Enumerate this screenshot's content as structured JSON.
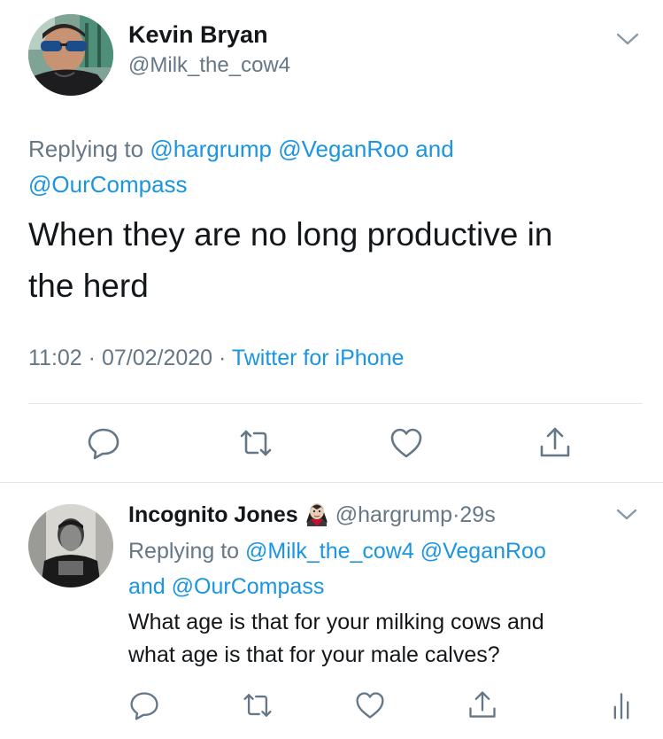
{
  "main_tweet": {
    "author_name": "Kevin Bryan",
    "author_handle": "@Milk_the_cow4",
    "replying_prefix": "Replying to",
    "replying_line1_mentions": "@hargrump @VeganRoo",
    "replying_and": "and",
    "replying_line2_mention": "@OurCompass",
    "text_line1": "When they are no long productive in",
    "text_line2": "the herd",
    "time": "11:02",
    "date": "07/02/2020",
    "source": "Twitter for iPhone",
    "dot": "·"
  },
  "reply_tweet": {
    "author_name": "Incognito Jones",
    "author_handle": "@hargrump",
    "age": "29s",
    "dot": "·",
    "replying_prefix": "Replying to",
    "replying_line1_mentions": "@Milk_the_cow4 @VeganRoo",
    "replying_and": "and",
    "replying_line2_mention": "@OurCompass",
    "text_line1": "What age is that for your milking cows and",
    "text_line2": "what age is that for your male calves?"
  },
  "icons": {
    "chevron": "chevron-down-icon",
    "reply": "reply-icon",
    "retweet": "retweet-icon",
    "like": "heart-icon",
    "share": "share-icon",
    "analytics": "analytics-icon",
    "emoji": "vampire-emoji"
  },
  "colors": {
    "link": "#1b95e0",
    "muted": "#657786",
    "icon": "#657786",
    "divider": "#e1e8ed",
    "text": "#14171a"
  }
}
